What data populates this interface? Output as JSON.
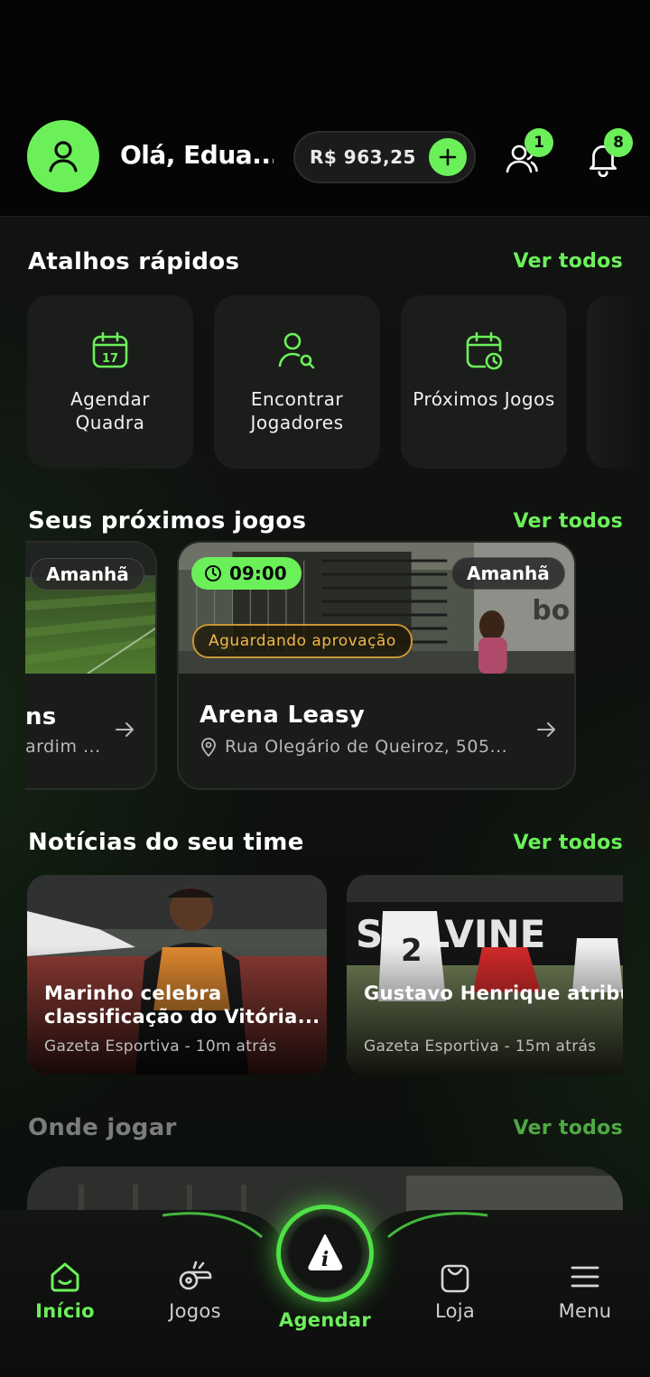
{
  "header": {
    "greeting": "Olá, Edua...",
    "wallet_amount": "R$ 963,25",
    "friends_badge": "1",
    "notifications_badge": "8"
  },
  "shortcuts": {
    "title": "Atalhos rápidos",
    "see_all": "Ver todos",
    "items": [
      {
        "label": "Agendar Quadra",
        "icon": "calendar-17-icon",
        "day": "17"
      },
      {
        "label": "Encontrar Jogadores",
        "icon": "user-search-icon"
      },
      {
        "label": "Próximos Jogos",
        "icon": "calendar-clock-icon"
      }
    ]
  },
  "games": {
    "title": "Seus próximos jogos",
    "see_all": "Ver todos",
    "items": [
      {
        "when": "Amanhã",
        "name_fragment": "ns",
        "address_fragment": "ardim ..."
      },
      {
        "when": "Amanhã",
        "time": "09:00",
        "status": "Aguardando aprovação",
        "name": "Arena Leasy",
        "address": "Rua Olegário de Queiroz, 505..."
      }
    ]
  },
  "news": {
    "title": "Notícias do seu time",
    "see_all": "Ver todos",
    "items": [
      {
        "headline": "Marinho celebra classificação do Vitória...",
        "meta": "Gazeta Esportiva - 10m atrás"
      },
      {
        "headline": "Gustavo Henrique atribui queda do Corinthians c...",
        "meta": "Gazeta Esportiva - 15m atrás"
      }
    ]
  },
  "where": {
    "title": "Onde jogar",
    "see_all": "Ver todos"
  },
  "nav": {
    "home": "Início",
    "games": "Jogos",
    "schedule": "Agendar",
    "shop": "Loja",
    "menu": "Menu"
  },
  "colors": {
    "accent": "#6cf05a",
    "background": "#0b0c0b",
    "card": "#1b1d1b",
    "warning": "#f0b84a"
  }
}
